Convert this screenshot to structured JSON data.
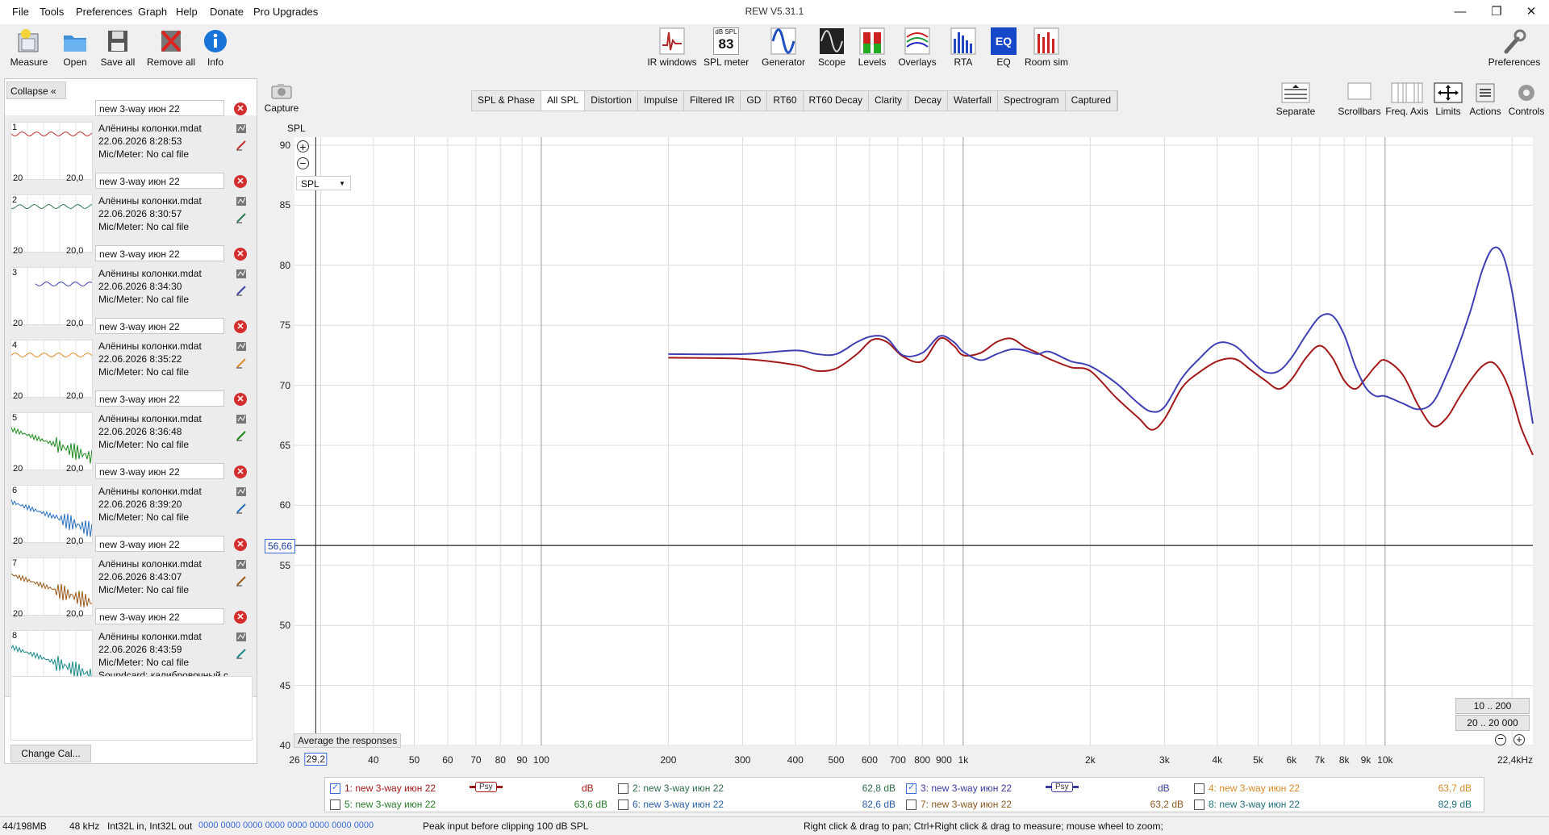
{
  "window": {
    "title": "REW V5.31.1"
  },
  "menu": [
    "File",
    "Tools",
    "Preferences",
    "Graph",
    "Help",
    "Donate",
    "Pro Upgrades"
  ],
  "toolbar_left": [
    {
      "label": "Measure",
      "icon": "microphone-icon"
    },
    {
      "label": "Open",
      "icon": "folder-icon"
    },
    {
      "label": "Save all",
      "icon": "save-icon"
    },
    {
      "label": "Remove all",
      "icon": "remove-icon"
    },
    {
      "label": "Info",
      "icon": "info-icon"
    }
  ],
  "toolbar_center": [
    {
      "label": "IR windows",
      "icon": "ir-windows-icon"
    },
    {
      "label": "SPL meter",
      "icon": "spl-meter-icon",
      "badge_top": "dB SPL",
      "badge_value": "83"
    },
    {
      "label": "Generator",
      "icon": "generator-icon"
    },
    {
      "label": "Scope",
      "icon": "scope-icon"
    },
    {
      "label": "Levels",
      "icon": "levels-icon"
    },
    {
      "label": "Overlays",
      "icon": "overlays-icon"
    },
    {
      "label": "RTA",
      "icon": "rta-icon"
    },
    {
      "label": "EQ",
      "icon": "eq-icon"
    },
    {
      "label": "Room sim",
      "icon": "room-sim-icon"
    }
  ],
  "toolbar_right": {
    "label": "Preferences",
    "icon": "wrench-icon"
  },
  "graph_controls": [
    {
      "label": "Separate",
      "icon": "separate-icon"
    },
    {
      "label": "Scrollbars",
      "icon": "scrollbars-icon"
    },
    {
      "label": "Freq. Axis",
      "icon": "freq-axis-icon"
    },
    {
      "label": "Limits",
      "icon": "limits-icon"
    },
    {
      "label": "Actions",
      "icon": "actions-icon"
    },
    {
      "label": "Controls",
      "icon": "controls-icon"
    }
  ],
  "capture": {
    "label": "Capture"
  },
  "tabs": [
    "SPL & Phase",
    "All SPL",
    "Distortion",
    "Impulse",
    "Filtered IR",
    "GD",
    "RT60",
    "RT60 Decay",
    "Clarity",
    "Decay",
    "Waterfall",
    "Spectrogram",
    "Captured"
  ],
  "active_tab": "All SPL",
  "panel": {
    "collapse_label": "Collapse",
    "change_cal_label": "Change Cal...",
    "thumb_tick_left": "20",
    "thumb_tick_right": "20,0",
    "measurements": [
      {
        "num": "1",
        "name": "new 3-way июн 22",
        "file": "Алёнины колонки.mdat",
        "date": "22.06.2026 8:28:53",
        "mic": "Mic/Meter: No cal file",
        "color": "#c03030"
      },
      {
        "num": "2",
        "name": "new 3-way июн 22",
        "file": "Алёнины колонки.mdat",
        "date": "22.06.2026 8:30:57",
        "mic": "Mic/Meter: No cal file",
        "color": "#2e7d4f"
      },
      {
        "num": "3",
        "name": "new 3-way июн 22",
        "file": "Алёнины колонки.mdat",
        "date": "22.06.2026 8:34:30",
        "mic": "Mic/Meter: No cal file",
        "color": "#3f3fb0"
      },
      {
        "num": "4",
        "name": "new 3-way июн 22",
        "file": "Алёнины колонки.mdat",
        "date": "22.06.2026 8:35:22",
        "mic": "Mic/Meter: No cal file",
        "color": "#e08a2a"
      },
      {
        "num": "5",
        "name": "new 3-way июн 22",
        "file": "Алёнины колонки.mdat",
        "date": "22.06.2026 8:36:48",
        "mic": "Mic/Meter: No cal file",
        "color": "#1e8a1e"
      },
      {
        "num": "6",
        "name": "new 3-way июн 22",
        "file": "Алёнины колонки.mdat",
        "date": "22.06.2026 8:39:20",
        "mic": "Mic/Meter: No cal file",
        "color": "#2a6fbf"
      },
      {
        "num": "7",
        "name": "new 3-way июн 22",
        "file": "Алёнины колонки.mdat",
        "date": "22.06.2026 8:43:07",
        "mic": "Mic/Meter: No cal file",
        "color": "#9a5a1a"
      },
      {
        "num": "8",
        "name": "new 3-way июн 22",
        "file": "Алёнины колонки.mdat",
        "date": "22.06.2026 8:43:59",
        "mic": "Mic/Meter: No cal file",
        "soundcard": "Soundcard: калибровочный с",
        "color": "#1a8a8a"
      }
    ]
  },
  "graph": {
    "y_axis_title": "SPL",
    "y_select": "SPL",
    "y_ticks": [
      "90",
      "85",
      "80",
      "75",
      "70",
      "65",
      "60",
      "55",
      "50",
      "45",
      "40"
    ],
    "x_ticks": [
      "26",
      "29,2",
      "40",
      "50",
      "60",
      "70",
      "80",
      "90",
      "100",
      "200",
      "300",
      "400",
      "500",
      "600",
      "700",
      "800",
      "900",
      "1k",
      "2k",
      "3k",
      "4k",
      "5k",
      "6k",
      "7k",
      "8k",
      "9k",
      "10k",
      "22,4kHz"
    ],
    "cursor_value": "56,66",
    "average_label": "Average the responses",
    "range_btn1": "10 .. 200",
    "range_btn2": "20 .. 20 000"
  },
  "chart_data": {
    "type": "line",
    "ylabel": "SPL",
    "xlim": [
      26,
      22400
    ],
    "ylim": [
      40,
      90
    ],
    "x_scale": "log",
    "grid": true,
    "series": [
      {
        "name": "1: new 3-way июн 22",
        "color": "#a31818",
        "x": [
          200,
          300,
          400,
          450,
          500,
          560,
          610,
          660,
          720,
          800,
          880,
          950,
          1000,
          1100,
          1200,
          1300,
          1400,
          1500,
          1600,
          1800,
          2000,
          2300,
          2600,
          2800,
          3000,
          3300,
          3600,
          4000,
          4400,
          4800,
          5200,
          5600,
          6000,
          6500,
          7000,
          7500,
          8000,
          8500,
          9000,
          9500,
          10000,
          11000,
          12000,
          13000,
          14000,
          15000,
          16000,
          17000,
          18000,
          19000,
          20000,
          21000,
          22400
        ],
        "y": [
          72.3,
          72.2,
          71.7,
          71.2,
          71.4,
          72.6,
          73.8,
          73.6,
          72.4,
          72.0,
          73.9,
          73.3,
          72.5,
          72.7,
          73.6,
          73.9,
          73.2,
          72.7,
          72.2,
          71.5,
          71.2,
          69.0,
          67.3,
          66.3,
          67.2,
          69.8,
          71.0,
          72.0,
          72.2,
          71.3,
          70.4,
          69.7,
          70.5,
          72.3,
          73.3,
          72.3,
          70.4,
          69.7,
          70.6,
          71.6,
          72.1,
          70.9,
          68.3,
          66.6,
          67.3,
          69.0,
          70.5,
          71.6,
          71.9,
          70.9,
          69.0,
          66.5,
          64.2
        ]
      },
      {
        "name": "3: new 3-way июн 22",
        "color": "#4040b4",
        "x": [
          200,
          300,
          400,
          450,
          500,
          560,
          610,
          660,
          720,
          800,
          880,
          950,
          1000,
          1100,
          1200,
          1300,
          1400,
          1500,
          1600,
          1800,
          2000,
          2300,
          2600,
          2800,
          3000,
          3300,
          3600,
          4000,
          4400,
          4800,
          5200,
          5600,
          6000,
          6500,
          7000,
          7500,
          8000,
          8500,
          9000,
          9500,
          10000,
          11000,
          12000,
          13000,
          14000,
          15000,
          16000,
          17000,
          18000,
          19000,
          20000,
          21000,
          22400
        ],
        "y": [
          72.6,
          72.6,
          72.9,
          72.6,
          72.6,
          73.6,
          74.1,
          73.9,
          72.5,
          72.7,
          74.1,
          73.6,
          72.8,
          72.1,
          72.6,
          73.0,
          72.9,
          72.6,
          72.8,
          72.0,
          71.6,
          70.2,
          68.5,
          67.8,
          68.2,
          70.6,
          72.1,
          73.5,
          73.3,
          72.1,
          71.1,
          71.2,
          72.3,
          74.2,
          75.7,
          75.8,
          74.2,
          71.6,
          69.8,
          69.1,
          69.1,
          68.5,
          68.0,
          68.6,
          70.9,
          73.5,
          76.4,
          79.6,
          81.4,
          80.9,
          77.8,
          73.0,
          66.8
        ]
      }
    ]
  },
  "legend": [
    {
      "label": "1: new 3-way июн 22",
      "checked": true,
      "psy": "Psy",
      "unit": "dB",
      "value": "",
      "color": "#a31818"
    },
    {
      "label": "2: new 3-way июн 22",
      "checked": false,
      "value": "62,8 dB",
      "color": "#2e6e4a"
    },
    {
      "label": "3: new 3-way июн 22",
      "checked": true,
      "psy": "Psy",
      "unit": "dB",
      "value": "",
      "color": "#3a3aa0"
    },
    {
      "label": "4: new 3-way июн 22",
      "checked": false,
      "value": "63,7 dB",
      "color": "#d98a2a"
    },
    {
      "label": "5: new 3-way июн 22",
      "checked": false,
      "value": "63,6 dB",
      "color": "#2a7a2a"
    },
    {
      "label": "6: new 3-way июн 22",
      "checked": false,
      "value": "82,6 dB",
      "color": "#2a5fa8"
    },
    {
      "label": "7: new 3-way июн 22",
      "checked": false,
      "value": "63,2 dB",
      "color": "#8a5a20"
    },
    {
      "label": "8: new 3-way июн 22",
      "checked": false,
      "value": "82,9 dB",
      "color": "#1f6f7a"
    }
  ],
  "status": {
    "memory": "44/198MB",
    "rate": "48 kHz",
    "format": "Int32L in, Int32L out",
    "bits": "0000 0000  0000 0000  0000 0000  0000 0000",
    "peak": "Peak input before clipping 100 dB SPL",
    "hint": "Right click & drag to pan; Ctrl+Right click & drag to measure; mouse wheel to zoom;"
  }
}
